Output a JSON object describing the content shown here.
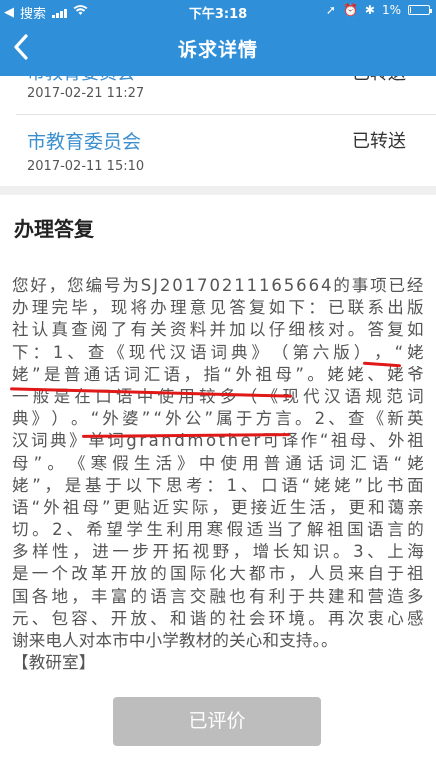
{
  "status_bar": {
    "carrier": "搜索",
    "time": "下午3:18",
    "battery": "1%"
  },
  "nav": {
    "title": "诉求详情",
    "back_icon": "chevron-left-icon"
  },
  "records": [
    {
      "department": "市教育委员会",
      "status": "已转送",
      "time": "2017-02-21 11:27"
    },
    {
      "department": "市教育委员会",
      "status": "已转送",
      "time": "2017-02-11 15:10"
    }
  ],
  "reply": {
    "section_title": "办理答复",
    "lines": [
      "您好，您编号为SJ20170211165664的事项已经",
      "办理完毕，现将办理意见答复如下：已联系出版",
      "社认真查阅了有关资料并加以仔细核对。答复如",
      "下：1、查《现代汉语词典》（第六版），“姥",
      "姥”是普通话词汇语，指“外祖母”。姥姥、姥爷",
      "一般是在口语中使用较多（《现代汉语规范词",
      "典》）。“外婆”“外公”属于方言。2、查《新英",
      "汉词典》单词grandmother可译作“祖母、外祖",
      "母”。《寒假生活》中使用普通话词汇语“姥",
      "姥”，是基于以下思考：1、口语“姥姥”比书面",
      "语“外祖母”更贴近实际，更接近生活，更和蔼亲",
      "切。2、希望学生利用寒假适当了解祖国语言的",
      "多样性，进一步开拓视野，增长知识。3、上海",
      "是一个改革开放的国际化大都市，人员来自于祖",
      "国各地，丰富的语言交融也有利于共建和营造多",
      "元、包容、开放、和谐的社会环境。再次衷心感",
      "谢来电人对本市中小学教材的关心和支持。。",
      "【教研室】"
    ]
  },
  "rate_button": {
    "label": "已评价"
  },
  "colors": {
    "header_blue": "#2f8fd8",
    "link_blue": "#3c8fcf",
    "underline_red": "#e01818",
    "button_gray": "#bdbdbd"
  }
}
